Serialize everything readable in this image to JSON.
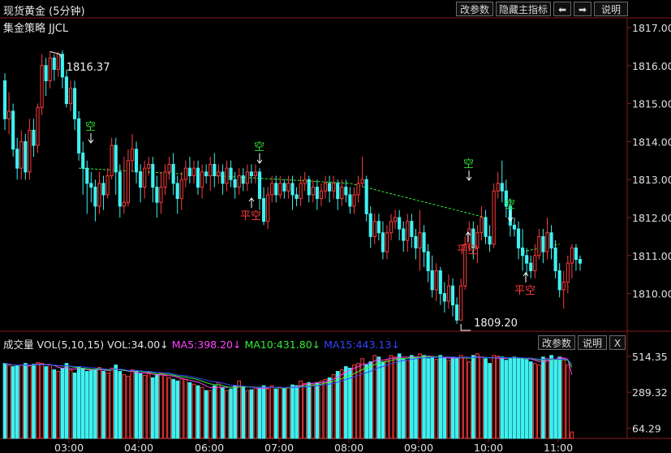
{
  "window": {
    "title": "现货黄金 (5分钟)"
  },
  "toolbar": {
    "params_label": "改参数",
    "hide_indicator_label": "隐藏主指标",
    "prev_label": "⬅",
    "next_label": "➡",
    "help_label": "说明"
  },
  "strategy": {
    "name": "集金策略 JJCL"
  },
  "signals": [
    {
      "text": "空",
      "type": "short",
      "color": "#33dd33"
    },
    {
      "text": "空",
      "type": "short",
      "color": "#33dd33"
    },
    {
      "text": "平空",
      "type": "cover",
      "color": "#ff3b3b"
    },
    {
      "text": "平空",
      "type": "cover",
      "color": "#ff3b3b"
    },
    {
      "text": "空",
      "type": "short",
      "color": "#33dd33"
    },
    {
      "text": "空",
      "type": "short",
      "color": "#33dd33"
    },
    {
      "text": "平空",
      "type": "cover",
      "color": "#ff3b3b"
    }
  ],
  "annotations": {
    "high_label": "1816.37",
    "low_label": "1809.20"
  },
  "volume_panel": {
    "title": "成交量",
    "indicator": "VOL(5,10,15)",
    "vol": "VOL:34.00↓",
    "ma5": "MA5:398.20↓",
    "ma10": "MA10:431.80↓",
    "ma15": "MA15:443.13↓",
    "params_label": "改参数",
    "help_label": "说明",
    "close_label": "X",
    "ticks": [
      "514.35",
      "289.32",
      "64.29"
    ]
  },
  "price_axis": {
    "ticks": [
      "1817.00",
      "1816.00",
      "1815.00",
      "1814.00",
      "1813.00",
      "1812.00",
      "1811.00",
      "1810.00"
    ]
  },
  "time_axis": {
    "ticks": [
      "03:00",
      "04:00",
      "06:00",
      "07:00",
      "08:00",
      "09:00",
      "10:00",
      "11:00"
    ]
  },
  "colors": {
    "up": "#ff3b3b",
    "down": "#3ff0f0",
    "ma5": "#ff44ff",
    "ma10": "#33ee33",
    "ma15": "#3344ff",
    "grid": "#8a1a1a",
    "trend": "#33ee33"
  },
  "chart_data": {
    "type": "candlestick",
    "ylim": [
      1809,
      1817
    ],
    "candles": [
      [
        1815.6,
        1814.6,
        1815.8,
        1814.3
      ],
      [
        1814.6,
        1814.8,
        1815.3,
        1814.2
      ],
      [
        1814.8,
        1813.8,
        1815.0,
        1813.6
      ],
      [
        1813.8,
        1813.3,
        1814.1,
        1813.0
      ],
      [
        1813.3,
        1814.0,
        1814.3,
        1813.0
      ],
      [
        1814.0,
        1813.2,
        1814.2,
        1813.0
      ],
      [
        1813.2,
        1814.3,
        1814.6,
        1813.0
      ],
      [
        1814.3,
        1813.9,
        1814.6,
        1813.6
      ],
      [
        1813.9,
        1814.9,
        1815.0,
        1813.7
      ],
      [
        1814.9,
        1816.0,
        1816.3,
        1814.7
      ],
      [
        1816.0,
        1815.6,
        1816.2,
        1815.2
      ],
      [
        1815.6,
        1816.2,
        1816.37,
        1815.4
      ],
      [
        1816.2,
        1815.9,
        1816.3,
        1815.6
      ],
      [
        1815.9,
        1816.3,
        1816.35,
        1815.7
      ],
      [
        1816.3,
        1815.7,
        1816.4,
        1815.4
      ],
      [
        1815.7,
        1815.0,
        1815.9,
        1814.9
      ],
      [
        1815.0,
        1815.4,
        1815.6,
        1814.8
      ],
      [
        1815.4,
        1814.6,
        1815.6,
        1814.3
      ],
      [
        1814.6,
        1813.7,
        1814.8,
        1813.5
      ],
      [
        1813.7,
        1813.3,
        1814.0,
        1812.6
      ],
      [
        1813.3,
        1812.9,
        1813.5,
        1812.1
      ],
      [
        1812.9,
        1812.8,
        1813.2,
        1812.4
      ],
      [
        1812.8,
        1812.3,
        1813.0,
        1811.9
      ],
      [
        1812.3,
        1812.9,
        1813.2,
        1812.1
      ],
      [
        1812.9,
        1812.6,
        1813.1,
        1812.2
      ],
      [
        1812.6,
        1813.1,
        1813.3,
        1812.5
      ],
      [
        1813.1,
        1813.9,
        1814.1,
        1813.0
      ],
      [
        1813.9,
        1813.2,
        1814.1,
        1812.6
      ],
      [
        1813.2,
        1812.3,
        1813.4,
        1812.0
      ],
      [
        1812.3,
        1812.4,
        1813.6,
        1812.1
      ],
      [
        1812.4,
        1813.5,
        1813.8,
        1812.3
      ],
      [
        1813.5,
        1813.8,
        1814.2,
        1813.2
      ],
      [
        1813.8,
        1813.2,
        1814.0,
        1812.9
      ],
      [
        1813.2,
        1812.8,
        1813.4,
        1812.4
      ],
      [
        1812.8,
        1813.3,
        1813.5,
        1812.5
      ],
      [
        1813.3,
        1813.4,
        1813.6,
        1813.1
      ],
      [
        1813.4,
        1812.8,
        1813.6,
        1812.4
      ],
      [
        1812.8,
        1812.4,
        1813.1,
        1812.0
      ],
      [
        1812.4,
        1812.8,
        1813.2,
        1812.1
      ],
      [
        1812.8,
        1813.2,
        1813.4,
        1812.6
      ],
      [
        1813.2,
        1813.4,
        1813.6,
        1813.0
      ],
      [
        1813.4,
        1812.9,
        1813.7,
        1812.6
      ],
      [
        1812.9,
        1812.5,
        1813.1,
        1812.1
      ],
      [
        1812.5,
        1813.0,
        1813.2,
        1812.2
      ],
      [
        1813.0,
        1813.3,
        1813.5,
        1812.8
      ],
      [
        1813.3,
        1813.1,
        1813.6,
        1812.9
      ],
      [
        1813.1,
        1813.3,
        1813.5,
        1812.9
      ],
      [
        1813.3,
        1812.8,
        1813.5,
        1812.6
      ],
      [
        1812.8,
        1813.2,
        1813.4,
        1812.5
      ],
      [
        1813.2,
        1813.1,
        1813.4,
        1812.9
      ],
      [
        1813.1,
        1813.4,
        1813.6,
        1812.7
      ],
      [
        1813.4,
        1813.1,
        1813.7,
        1812.8
      ],
      [
        1813.1,
        1813.2,
        1813.4,
        1812.9
      ],
      [
        1813.2,
        1812.9,
        1813.4,
        1812.6
      ],
      [
        1812.9,
        1813.3,
        1813.5,
        1812.7
      ],
      [
        1813.3,
        1813.0,
        1813.5,
        1812.8
      ],
      [
        1813.0,
        1812.8,
        1813.2,
        1812.5
      ],
      [
        1812.8,
        1813.1,
        1813.3,
        1812.6
      ],
      [
        1813.1,
        1812.9,
        1813.3,
        1812.7
      ],
      [
        1812.9,
        1813.2,
        1813.4,
        1812.7
      ],
      [
        1813.2,
        1813.1,
        1813.4,
        1812.9
      ],
      [
        1813.1,
        1813.2,
        1813.4,
        1812.9
      ],
      [
        1813.2,
        1812.5,
        1813.3,
        1812.2
      ],
      [
        1812.5,
        1811.9,
        1812.8,
        1811.8
      ],
      [
        1811.9,
        1812.6,
        1812.8,
        1811.7
      ],
      [
        1812.6,
        1812.9,
        1813.1,
        1812.4
      ],
      [
        1812.9,
        1812.6,
        1813.1,
        1812.4
      ],
      [
        1812.6,
        1812.9,
        1813.1,
        1812.5
      ],
      [
        1812.9,
        1812.7,
        1813.0,
        1812.5
      ],
      [
        1812.7,
        1812.9,
        1813.1,
        1812.5
      ],
      [
        1812.9,
        1812.6,
        1813.1,
        1812.2
      ],
      [
        1812.6,
        1812.5,
        1812.8,
        1812.3
      ],
      [
        1812.5,
        1812.9,
        1813.1,
        1812.3
      ],
      [
        1812.9,
        1813.0,
        1813.2,
        1812.7
      ],
      [
        1813.0,
        1812.6,
        1813.1,
        1812.4
      ],
      [
        1812.6,
        1812.8,
        1813.0,
        1812.4
      ],
      [
        1812.8,
        1812.5,
        1813.0,
        1812.2
      ],
      [
        1812.5,
        1812.7,
        1812.9,
        1812.3
      ],
      [
        1812.7,
        1812.9,
        1813.1,
        1812.5
      ],
      [
        1812.9,
        1812.7,
        1813.1,
        1812.4
      ],
      [
        1812.7,
        1812.9,
        1813.1,
        1812.5
      ],
      [
        1812.9,
        1812.5,
        1813.0,
        1812.2
      ],
      [
        1812.5,
        1812.8,
        1813.0,
        1812.3
      ],
      [
        1812.8,
        1812.6,
        1813.0,
        1812.4
      ],
      [
        1812.6,
        1812.3,
        1812.8,
        1812.1
      ],
      [
        1812.3,
        1812.6,
        1812.8,
        1812.1
      ],
      [
        1812.6,
        1812.9,
        1813.1,
        1812.4
      ],
      [
        1812.9,
        1813.0,
        1813.6,
        1812.8
      ],
      [
        1813.0,
        1812.1,
        1813.1,
        1811.9
      ],
      [
        1812.1,
        1811.5,
        1812.3,
        1811.2
      ],
      [
        1811.5,
        1811.9,
        1812.1,
        1811.3
      ],
      [
        1811.9,
        1811.6,
        1812.1,
        1811.4
      ],
      [
        1811.6,
        1811.1,
        1811.9,
        1810.9
      ],
      [
        1811.1,
        1811.6,
        1811.8,
        1810.9
      ],
      [
        1811.6,
        1811.9,
        1812.1,
        1811.4
      ],
      [
        1811.9,
        1812.0,
        1812.2,
        1811.7
      ],
      [
        1812.0,
        1811.7,
        1812.2,
        1811.4
      ],
      [
        1811.7,
        1811.4,
        1811.9,
        1811.1
      ],
      [
        1811.4,
        1811.9,
        1812.1,
        1811.1
      ],
      [
        1811.9,
        1811.5,
        1812.1,
        1811.2
      ],
      [
        1811.5,
        1811.2,
        1811.7,
        1810.9
      ],
      [
        1811.2,
        1811.6,
        1812.2,
        1810.6
      ],
      [
        1811.6,
        1811.1,
        1811.8,
        1810.7
      ],
      [
        1811.1,
        1810.6,
        1811.3,
        1810.3
      ],
      [
        1810.6,
        1810.1,
        1811.0,
        1809.9
      ],
      [
        1810.1,
        1810.6,
        1810.8,
        1809.8
      ],
      [
        1810.6,
        1810.0,
        1810.7,
        1809.7
      ],
      [
        1810.0,
        1809.8,
        1810.3,
        1809.5
      ],
      [
        1809.8,
        1810.2,
        1810.5,
        1809.6
      ],
      [
        1810.2,
        1809.7,
        1810.4,
        1809.4
      ],
      [
        1809.7,
        1809.3,
        1809.9,
        1809.2
      ],
      [
        1809.3,
        1810.2,
        1810.4,
        1809.3
      ],
      [
        1810.2,
        1811.3,
        1811.5,
        1810.1
      ],
      [
        1811.3,
        1811.7,
        1811.9,
        1811.1
      ],
      [
        1811.7,
        1811.2,
        1811.9,
        1810.9
      ],
      [
        1811.2,
        1811.6,
        1811.8,
        1810.8
      ],
      [
        1811.6,
        1812.0,
        1812.3,
        1811.4
      ],
      [
        1812.0,
        1811.5,
        1812.2,
        1811.3
      ],
      [
        1811.5,
        1811.3,
        1811.8,
        1811.1
      ],
      [
        1811.3,
        1812.7,
        1812.9,
        1811.2
      ],
      [
        1812.7,
        1812.9,
        1813.2,
        1812.5
      ],
      [
        1812.9,
        1812.7,
        1813.5,
        1812.4
      ],
      [
        1812.7,
        1812.3,
        1813.0,
        1812.0
      ],
      [
        1812.3,
        1811.8,
        1812.5,
        1811.5
      ],
      [
        1811.8,
        1811.7,
        1812.0,
        1811.5
      ],
      [
        1811.7,
        1811.2,
        1811.9,
        1810.9
      ],
      [
        1811.2,
        1811.0,
        1811.7,
        1810.6
      ],
      [
        1811.0,
        1810.8,
        1811.2,
        1810.5
      ],
      [
        1810.8,
        1810.6,
        1811.0,
        1810.4
      ],
      [
        1810.6,
        1811.0,
        1811.3,
        1810.4
      ],
      [
        1811.0,
        1811.5,
        1811.7,
        1810.9
      ],
      [
        1811.5,
        1811.1,
        1811.7,
        1810.8
      ],
      [
        1811.1,
        1811.6,
        1812.0,
        1810.9
      ],
      [
        1811.6,
        1811.2,
        1811.8,
        1810.9
      ],
      [
        1811.2,
        1810.6,
        1811.4,
        1810.4
      ],
      [
        1810.6,
        1810.1,
        1810.8,
        1809.9
      ],
      [
        1810.1,
        1810.3,
        1810.6,
        1809.6
      ],
      [
        1810.3,
        1810.8,
        1811.0,
        1810.0
      ],
      [
        1810.8,
        1811.2,
        1811.3,
        1810.4
      ],
      [
        1811.2,
        1810.9,
        1811.3,
        1810.6
      ],
      [
        1810.9,
        1810.8,
        1811.0,
        1810.6
      ]
    ],
    "volumes": [
      470,
      460,
      450,
      455,
      460,
      470,
      455,
      465,
      475,
      470,
      450,
      460,
      430,
      420,
      440,
      470,
      430,
      410,
      450,
      440,
      420,
      425,
      430,
      445,
      420,
      410,
      440,
      460,
      420,
      400,
      390,
      430,
      420,
      410,
      395,
      405,
      380,
      400,
      410,
      395,
      380,
      370,
      360,
      375,
      370,
      350,
      340,
      330,
      320,
      300,
      300,
      330,
      350,
      320,
      300,
      310,
      330,
      360,
      320,
      300,
      305,
      315,
      320,
      330,
      310,
      330,
      310,
      320,
      310,
      320,
      335,
      330,
      360,
      345,
      350,
      340,
      350,
      360,
      370,
      380,
      400,
      420,
      430,
      450,
      440,
      460,
      470,
      500,
      460,
      480,
      520,
      510,
      480,
      490,
      520,
      510,
      530,
      500,
      490,
      520,
      510,
      530,
      520,
      500,
      510,
      495,
      520,
      505,
      490,
      510,
      500,
      520,
      510,
      480,
      520,
      530,
      510,
      500,
      470,
      520,
      515,
      510,
      490,
      500,
      510,
      505,
      500,
      495,
      480,
      470,
      460,
      510,
      500,
      520,
      490,
      510,
      500,
      460,
      40
    ]
  }
}
